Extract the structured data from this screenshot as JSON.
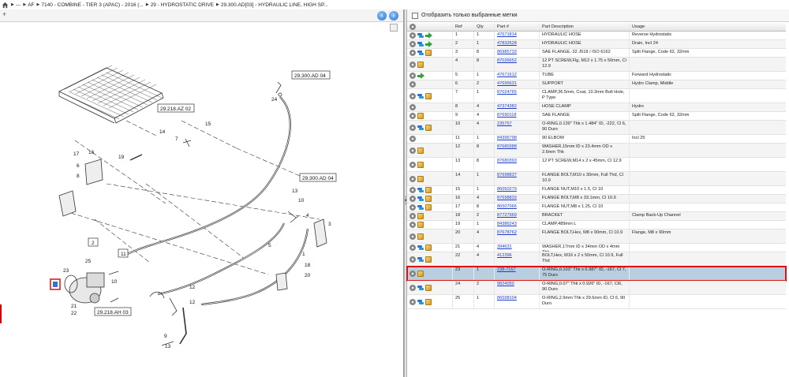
{
  "breadcrumb": {
    "items": [
      "---",
      "AF",
      "7140 - COMBINE - TIER 3 (APAC) - 2016 (...",
      "29 - HYDROSTATIC DRIVE",
      "29.300.AD[03] - HYDRAULIC LINE, HIGH SP..."
    ]
  },
  "filter": {
    "label": "Отобразить только выбранные метки"
  },
  "grid": {
    "headers": {
      "ref": "Ref",
      "qty": "Qty",
      "part": "Part #",
      "desc": "Part Description",
      "usage": "Usage"
    },
    "rows": [
      {
        "ref": "1",
        "qty": "1",
        "part": "47671814",
        "desc": "HYDRAULIC HOSE",
        "usage": "Reverse Hydrostatic",
        "icons": [
          "gear",
          "swap",
          "arrow"
        ]
      },
      {
        "ref": "2",
        "qty": "1",
        "part": "47832628",
        "desc": "HYDRAULIC HOSE",
        "usage": "Drain, Incl 24",
        "icons": [
          "gear",
          "swap",
          "arrow"
        ]
      },
      {
        "ref": "3",
        "qty": "8",
        "part": "86985733",
        "desc": "SAE FLANGE,-32 J518 / ISO 6162",
        "usage": "Split Flange, Code 62, 32mm",
        "icons": [
          "gear",
          "swap",
          "box"
        ]
      },
      {
        "ref": "4",
        "qty": "8",
        "part": "87026652",
        "desc": "12 PT SCREW,Flg, M12 x 1.75 x 50mm, Cl 12.9",
        "usage": "",
        "icons": [
          "gear",
          "box"
        ]
      },
      {
        "ref": "5",
        "qty": "1",
        "part": "47671612",
        "desc": "TUBE",
        "usage": "Forward Hydrostatic",
        "icons": [
          "gear",
          "arrow"
        ]
      },
      {
        "ref": "6",
        "qty": "2",
        "part": "47695631",
        "desc": "SUPPORT",
        "usage": "Hydro Clamp, Middle",
        "icons": [
          "gear"
        ]
      },
      {
        "ref": "7",
        "qty": "1",
        "part": "87024765",
        "desc": "CLAMP,36.5mm, Coat, 10.3mm Bolt Hole, P Type",
        "usage": "",
        "icons": [
          "gear",
          "swap",
          "box"
        ]
      },
      {
        "ref": "8",
        "qty": "4",
        "part": "47374382",
        "desc": "HOSE CLAMP",
        "usage": "Hydro",
        "icons": [
          "gear"
        ]
      },
      {
        "ref": "9",
        "qty": "4",
        "part": "87690118",
        "desc": "SAE FLANGE",
        "usage": "Split Flange, Code 62, 32mm",
        "icons": [
          "gear",
          "box"
        ]
      },
      {
        "ref": "10",
        "qty": "4",
        "part": "235757",
        "desc": "O-RING,0.139\" Thk x 1.484\" ID, -222, Cl 6, 90 Duro",
        "usage": "",
        "icons": [
          "gear",
          "swap",
          "box"
        ]
      },
      {
        "ref": "11",
        "qty": "1",
        "part": "84396798",
        "desc": "90 ELBOW",
        "usage": "Incl 25",
        "icons": [
          "gear"
        ]
      },
      {
        "ref": "12",
        "qty": "8",
        "part": "87680388",
        "desc": "WASHER,15mm ID x 23.4mm OD x 2.6mm Thk",
        "usage": "",
        "icons": [
          "gear",
          "box"
        ]
      },
      {
        "ref": "13",
        "qty": "8",
        "part": "87680393",
        "desc": "12 PT SCREW,M14 x 2 x 45mm, Cl 12.9",
        "usage": "",
        "icons": [
          "gear",
          "box"
        ]
      },
      {
        "ref": "14",
        "qty": "1",
        "part": "87698837",
        "desc": "FLANGE BOLT,M10 x 30mm, Full Thd, Cl 10.9",
        "usage": "",
        "icons": [
          "gear",
          "box"
        ]
      },
      {
        "ref": "15",
        "qty": "1",
        "part": "86050279",
        "desc": "FLANGE NUT,M10 x 1.5, Cl 10",
        "usage": "",
        "icons": [
          "gear",
          "swap",
          "box"
        ]
      },
      {
        "ref": "16",
        "qty": "4",
        "part": "87698833",
        "desc": "FLANGE BOLT,M8 x 33.1mm, Cl 10.9",
        "usage": "",
        "icons": [
          "gear",
          "swap",
          "box"
        ]
      },
      {
        "ref": "17",
        "qty": "8",
        "part": "86507066",
        "desc": "FLANGE NUT,M8 x 1.25, Cl 10",
        "usage": "",
        "icons": [
          "gear",
          "swap",
          "box"
        ]
      },
      {
        "ref": "18",
        "qty": "2",
        "part": "87727969",
        "desc": "BRACKET",
        "usage": "Clamp Back-Up Channel",
        "icons": [
          "gear",
          "box"
        ]
      },
      {
        "ref": "19",
        "qty": "1",
        "part": "84386243",
        "desc": "CLAMP,489mm L",
        "usage": "",
        "icons": [
          "gear",
          "box"
        ]
      },
      {
        "ref": "20",
        "qty": "4",
        "part": "87678762",
        "desc": "FLANGE BOLT,Hex, M8 x 90mm, Cl 10.9",
        "usage": "Flange, M8 x 90mm",
        "icons": [
          "gear",
          "box"
        ]
      },
      {
        "ref": "21",
        "qty": "4",
        "part": "394631",
        "desc": "WASHER,17mm ID x 34mm OD x 4mm Thk",
        "usage": "",
        "icons": [
          "gear",
          "swap",
          "box"
        ]
      },
      {
        "ref": "22",
        "qty": "4",
        "part": "412396",
        "desc": "BOLT,Hex, M16 x 2 x 50mm, Cl 10.9, Full Thd",
        "usage": "",
        "icons": [
          "gear",
          "swap",
          "box"
        ]
      },
      {
        "ref": "23",
        "qty": "1",
        "part": "238-7167",
        "desc": "O-RING,0.103\" Thk x 6.987\" ID, -167, Cl 7, 75 Duro",
        "usage": "",
        "icons": [
          "gear",
          "box"
        ],
        "selected": true
      },
      {
        "ref": "24",
        "qty": "2",
        "part": "9824050",
        "desc": "O-RING,0.07\" Thk x 0.926\" ID, -167, Cl6, 90 Duro",
        "usage": "",
        "icons": [
          "gear",
          "swap",
          "box"
        ]
      },
      {
        "ref": "25",
        "qty": "1",
        "part": "86598104",
        "desc": "O-RING,2.9mm Thk x 29.6mm ID, Cl 6, 90 Duro",
        "usage": "",
        "icons": [
          "gear",
          "swap",
          "box"
        ]
      }
    ]
  },
  "diagram": {
    "refs": {
      "r_29_300_ad_04_top": "29.300.AD 04",
      "r_29_218_az_02": "29.218.AZ 02",
      "r_29_300_ad_04_mid": "29.300.AD 04",
      "r_29_218_ah_03": "29.218.AH 03"
    },
    "callouts": [
      "24",
      "14",
      "7",
      "15",
      "19",
      "17",
      "16",
      "6",
      "8",
      "13",
      "10",
      "4",
      "3",
      "2",
      "5",
      "11",
      "25",
      "23",
      "12",
      "12",
      "10",
      "21",
      "22",
      "9",
      "13",
      "1",
      "18",
      "20"
    ]
  }
}
